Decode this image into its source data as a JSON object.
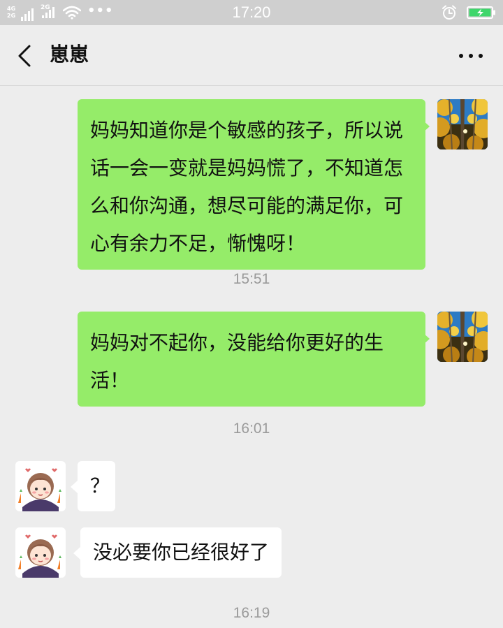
{
  "status_bar": {
    "network_top": "4G",
    "network_bottom": "2G",
    "network_2g": "2G",
    "more_dots": "•••",
    "time": "17:20",
    "icons": [
      "signal-icon",
      "wifi-icon",
      "alarm-icon",
      "battery-charging-icon"
    ]
  },
  "header": {
    "title": "崽崽",
    "back_icon": "chevron-left-icon",
    "more_icon": "more-dots-icon"
  },
  "messages": [
    {
      "side": "sent",
      "text": "妈妈知道你是个敏感的孩子，所以说话一会一变就是妈妈慌了，不知道怎么和你沟通，想尽可能的满足你，可心有余力不足，惭愧呀！"
    },
    {
      "type": "timestamp",
      "text": "15:51"
    },
    {
      "side": "sent",
      "text": "妈妈对不起你，没能给你更好的生活！"
    },
    {
      "type": "timestamp",
      "text": "16:01"
    },
    {
      "side": "received",
      "text": "？"
    },
    {
      "side": "received",
      "text": "没必要你已经很好了"
    },
    {
      "type": "timestamp",
      "text": "16:19"
    }
  ],
  "colors": {
    "background": "#ededed",
    "sent_bubble": "#95ec69",
    "received_bubble": "#ffffff",
    "timestamp_text": "#9a9a9a",
    "status_bar": "#cfcfcf"
  }
}
